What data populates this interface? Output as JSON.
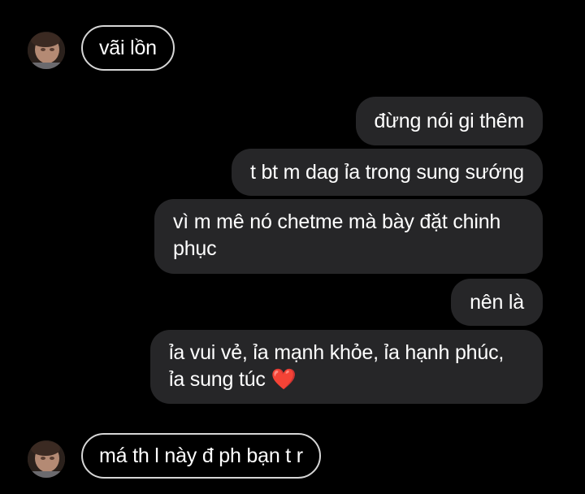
{
  "conversation": {
    "messages": [
      {
        "sender": "other",
        "text": "vãi lồn"
      },
      {
        "sender": "me",
        "text": "đừng nói gi thêm"
      },
      {
        "sender": "me",
        "text": "t bt m dag ỉa trong sung sướng"
      },
      {
        "sender": "me",
        "text": "vì m mê nó chetme mà bày đặt chinh phục"
      },
      {
        "sender": "me",
        "text": "nên là"
      },
      {
        "sender": "me",
        "text": "ỉa vui vẻ, ỉa mạnh khỏe, ỉa hạnh phúc, ỉa sung túc",
        "emoji": "❤️"
      },
      {
        "sender": "other",
        "text": "má th l này đ ph bạn t r"
      }
    ]
  },
  "colors": {
    "background": "#000000",
    "outgoing_bubble": "#262628",
    "incoming_border": "#d6d6d6",
    "text": "#ffffff",
    "heart": "#e0162b"
  },
  "icons": {
    "avatar": "user-avatar-photo",
    "heart": "red-heart-emoji"
  }
}
